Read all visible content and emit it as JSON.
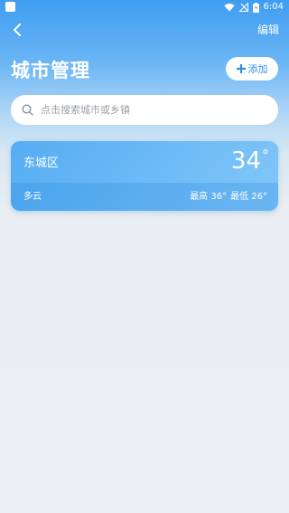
{
  "status_bar": {
    "time": "6:04",
    "icons": [
      "app-notification-icon",
      "wifi-icon",
      "no-signal-icon",
      "battery-icon"
    ]
  },
  "nav": {
    "back_icon": "chevron-left-icon",
    "edit_label": "编辑"
  },
  "header": {
    "title": "城市管理",
    "add_label": "添加",
    "add_icon": "plus-icon"
  },
  "search": {
    "placeholder": "点击搜索城市或乡镇",
    "icon": "search-icon"
  },
  "cities": [
    {
      "name": "东城区",
      "temperature": "34",
      "degree_symbol": "°",
      "condition": "多云",
      "high": "最高 36°",
      "low": "最低 26°"
    }
  ],
  "colors": {
    "accent": "#2f8fe6",
    "card": "#5eb2f4",
    "background": "#eceff3"
  }
}
